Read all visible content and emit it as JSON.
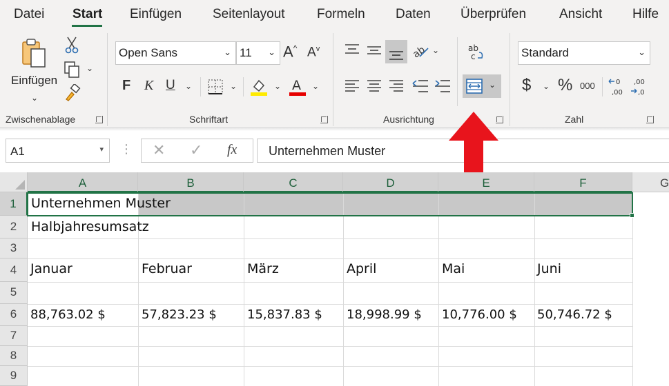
{
  "menu": {
    "tabs": [
      "Datei",
      "Start",
      "Einfügen",
      "Seitenlayout",
      "Formeln",
      "Daten",
      "Überprüfen",
      "Ansicht",
      "Hilfe"
    ],
    "active": "Start"
  },
  "ribbon": {
    "clipboard": {
      "paste_label": "Einfügen",
      "group_label": "Zwischenablage"
    },
    "font": {
      "family": "Open Sans",
      "size": "11",
      "bold": "F",
      "italic": "K",
      "underline": "U",
      "group_label": "Schriftart"
    },
    "alignment": {
      "group_label": "Ausrichtung"
    },
    "number": {
      "format": "Standard",
      "currency": "$",
      "percent": "%",
      "thousands": "000",
      "group_label": "Zahl"
    }
  },
  "formula_bar": {
    "name_box": "A1",
    "fx": "fx",
    "content": "Unternehmen Muster"
  },
  "sheet": {
    "columns": [
      "A",
      "B",
      "C",
      "D",
      "E",
      "F",
      "G"
    ],
    "rows": [
      "1",
      "2",
      "3",
      "4",
      "5",
      "6",
      "7",
      "8",
      "9"
    ],
    "cells": {
      "A1": "Unternehmen Muster",
      "A2": "Halbjahresumsatz",
      "A4": "Januar",
      "B4": "Februar",
      "C4": "März",
      "D4": "April",
      "E4": "Mai",
      "F4": "Juni",
      "A6": "88,763.02 $",
      "B6": "57,823.23 $",
      "C6": "15,837.83 $",
      "D6": "18,998.99 $",
      "E6": "10,776.00 $",
      "F6": "50,746.72 $"
    }
  },
  "colors": {
    "accent": "#217346",
    "arrow": "#e8141c",
    "selection_fill": "#c8c8c8"
  }
}
